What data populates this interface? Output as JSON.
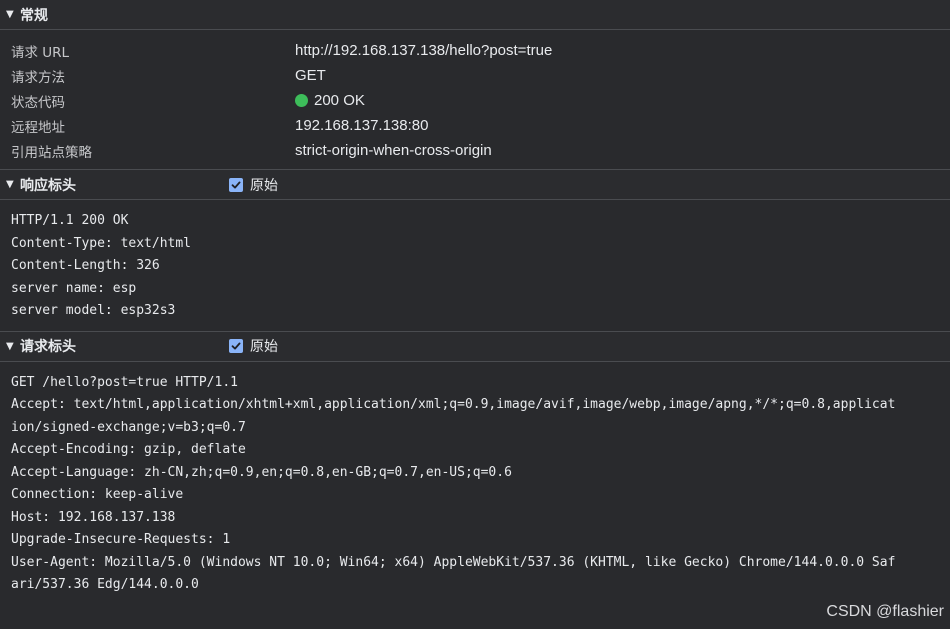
{
  "general": {
    "title": "常规",
    "rows": [
      {
        "key": "请求 URL",
        "value": "http://192.168.137.138/hello?post=true"
      },
      {
        "key": "请求方法",
        "value": "GET"
      },
      {
        "key": "状态代码",
        "value": "200 OK"
      },
      {
        "key": "远程地址",
        "value": "192.168.137.138:80"
      },
      {
        "key": "引用站点策略",
        "value": "strict-origin-when-cross-origin"
      }
    ],
    "status_color": "#3dbd5a"
  },
  "response_headers": {
    "title": "响应标头",
    "raw_label": "原始",
    "raw_checked": true,
    "lines": [
      "HTTP/1.1 200 OK",
      "Content-Type: text/html",
      "Content-Length: 326",
      "server name: esp",
      "server model: esp32s3"
    ]
  },
  "request_headers": {
    "title": "请求标头",
    "raw_label": "原始",
    "raw_checked": true,
    "lines": [
      "GET /hello?post=true HTTP/1.1",
      "Accept: text/html,application/xhtml+xml,application/xml;q=0.9,image/avif,image/webp,image/apng,*/*;q=0.8,applicat",
      "ion/signed-exchange;v=b3;q=0.7",
      "Accept-Encoding: gzip, deflate",
      "Accept-Language: zh-CN,zh;q=0.9,en;q=0.8,en-GB;q=0.7,en-US;q=0.6",
      "Connection: keep-alive",
      "Host: 192.168.137.138",
      "Upgrade-Insecure-Requests: 1",
      "User-Agent: Mozilla/5.0 (Windows NT 10.0; Win64; x64) AppleWebKit/537.36 (KHTML, like Gecko) Chrome/144.0.0.0 Saf",
      "ari/537.36 Edg/144.0.0.0"
    ]
  },
  "watermark": "CSDN @flashier",
  "icons": {
    "section_toggle": "triangle-down-icon",
    "checkbox": "checkmark-icon"
  },
  "colors": {
    "background": "#292a2d",
    "checkbox": "#8ab4f8",
    "divider": "#4a4c50"
  }
}
